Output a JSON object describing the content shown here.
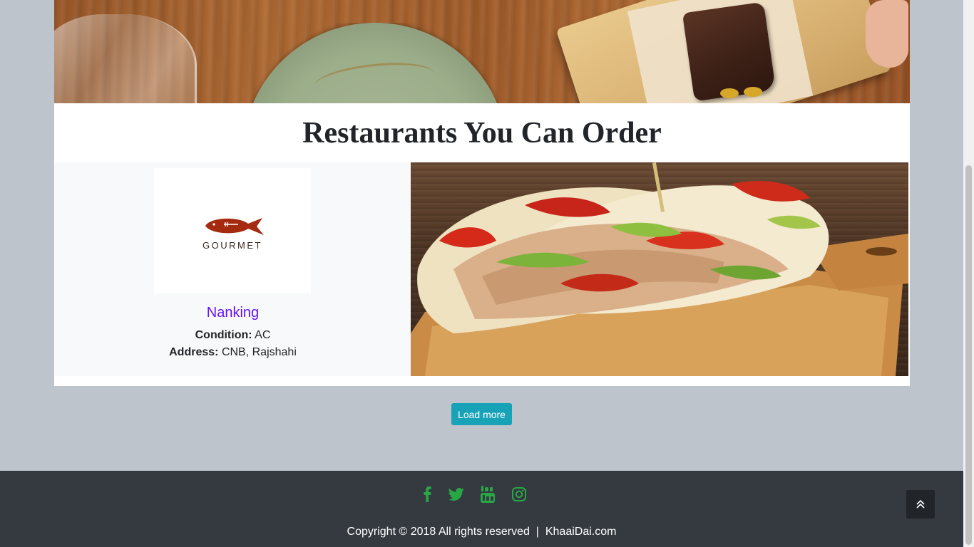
{
  "section": {
    "title": "Restaurants You Can Order"
  },
  "restaurant": {
    "logo_text": "GOURMET",
    "name": "Nanking",
    "condition_label": "Condition:",
    "condition_value": "AC",
    "address_label": "Address:",
    "address_value": "CNB, Rajshahi"
  },
  "load_more": {
    "label": "Load more"
  },
  "footer": {
    "social": [
      "facebook-icon",
      "twitter-icon",
      "youtube-icon",
      "instagram-icon"
    ],
    "social_color": "#28a745",
    "copyright": "Copyright © 2018 All rights reserved  |  KhaaiDai.com"
  },
  "colors": {
    "accent_button": "#17a2b8",
    "restaurant_name": "#6610f2",
    "footer_bg": "#343a40",
    "page_bg": "#bec4cb"
  }
}
